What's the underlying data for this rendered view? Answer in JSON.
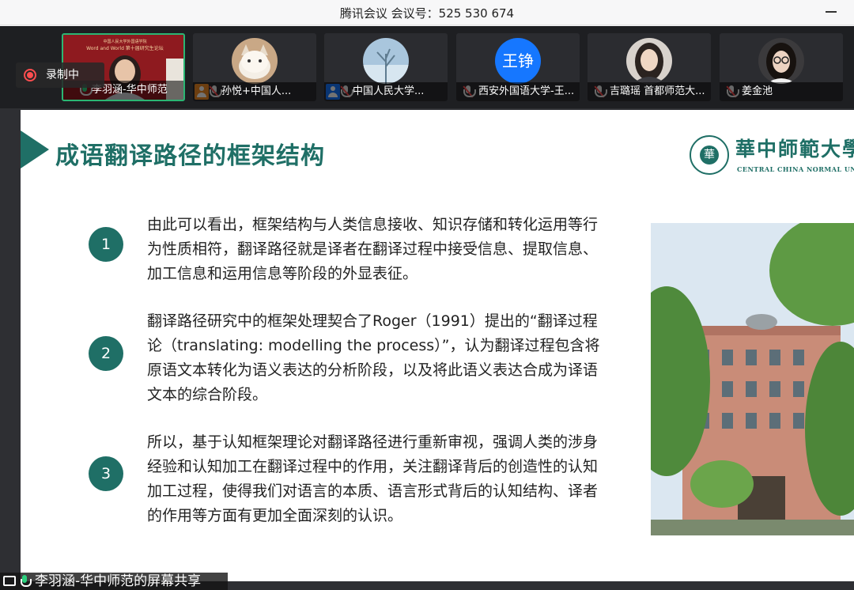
{
  "window": {
    "title": "腾讯会议 会议号：525 530 674"
  },
  "recording": {
    "label": "录制中"
  },
  "participants": [
    {
      "name": "李羽涵-华中师范",
      "mic": "live",
      "avatar": "photo-slide",
      "icon": "mic-icon",
      "poster_line1": "中国人民大学外国语学院",
      "poster_line2": "Word and World 第十届研究生论坛"
    },
    {
      "name": "孙悦+中国人...",
      "mic": "muted",
      "avatar": "photo-cat",
      "icon": "user-icon-orange"
    },
    {
      "name": "中国人民大学...",
      "mic": "muted",
      "avatar": "photo-winter",
      "icon": "user-icon-blue"
    },
    {
      "name": "西安外国语大学-王...",
      "mic": "muted",
      "avatar": "text",
      "avatar_text": "王铮"
    },
    {
      "name": "吉璐瑶  首都师范大...",
      "mic": "muted",
      "avatar": "photo-person"
    },
    {
      "name": "姜金池",
      "mic": "muted",
      "avatar": "photo-person-glasses"
    }
  ],
  "slide": {
    "title": "成语翻译路径的框架结构",
    "logo": {
      "seal_text": "華",
      "name_cn": "華中師範大學",
      "name_en": "CENTRAL CHINA NORMAL UNIVERSITY"
    },
    "points": [
      {
        "number": "1",
        "text": "由此可以看出，框架结构与人类信息接收、知识存储和转化运用等行为性质相符，翻译路径就是译者在翻译过程中接受信息、提取信息、加工信息和运用信息等阶段的外显表征。"
      },
      {
        "number": "2",
        "text": "翻译路径研究中的框架处理契合了Roger（1991）提出的“翻译过程论（translating: modelling the process）”，认为翻译过程包含将原语文本转化为语义表达的分析阶段，以及将此语义表达合成为译语文本的综合阶段。"
      },
      {
        "number": "3",
        "text": "所以，基于认知框架理论对翻译路径进行重新审视，强调人类的涉身经验和认知加工在翻译过程中的作用，关注翻译背后的创造性的认知加工过程，使得我们对语言的本质、语言形式背后的认知结构、译者的作用等方面有更加全面深刻的认识。"
      }
    ],
    "photo": "campus-building-photo"
  },
  "share": {
    "caption": "李羽涵-华中师范的屏幕共享"
  },
  "colors": {
    "accent": "#1f6f66",
    "live_mic": "#2bd17e",
    "record": "#ff4d4f",
    "avatar_blue": "#1677ff"
  }
}
